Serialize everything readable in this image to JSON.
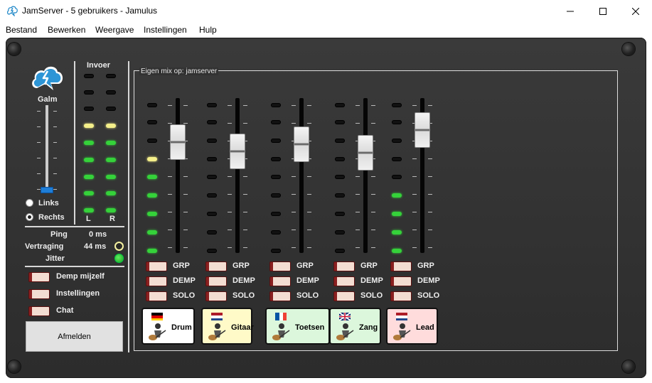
{
  "window": {
    "title": "JamServer - 5 gebruikers - Jamulus"
  },
  "menu": [
    "Bestand",
    "Bewerken",
    "Weergave",
    "Instellingen",
    "Hulp"
  ],
  "reverb": {
    "label": "Galm",
    "level": 0.08
  },
  "input": {
    "label": "Invoer",
    "left_label": "L",
    "right_label": "R"
  },
  "channel_select": {
    "left": "Links",
    "right": "Rechts",
    "selected": "right"
  },
  "stats": [
    {
      "label": "Ping",
      "value": "0 ms"
    },
    {
      "label": "Vertraging",
      "value": "44 ms"
    },
    {
      "label": "Jitter",
      "value": ""
    }
  ],
  "toggles": [
    "Demp mijzelf",
    "Instellingen",
    "Chat"
  ],
  "logout_label": "Afmelden",
  "mix": {
    "title": "Eigen mix op: jamserver",
    "button_labels": {
      "grp": "GRP",
      "mute": "DEMP",
      "solo": "SOLO"
    },
    "channels": [
      {
        "name": "Drum",
        "card_color": "#ffffff",
        "flag": "de",
        "level": 0.78
      },
      {
        "name": "Gitaar",
        "card_color": "#fffac8",
        "flag": "nl",
        "level": 0.7
      },
      {
        "name": "Toetsen",
        "card_color": "#dcf7dc",
        "flag": "fr",
        "level": 0.76
      },
      {
        "name": "Zang",
        "card_color": "#dcf7dc",
        "flag": "gb",
        "level": 0.69
      },
      {
        "name": "Lead",
        "card_color": "#ffdcdc",
        "flag": "nl",
        "level": 0.88
      }
    ]
  },
  "colors": {
    "panel": "#323232",
    "led_green": "#35d23a",
    "led_yellow": "#f4ef8a",
    "reverb_knob": "#1e7ed8"
  }
}
